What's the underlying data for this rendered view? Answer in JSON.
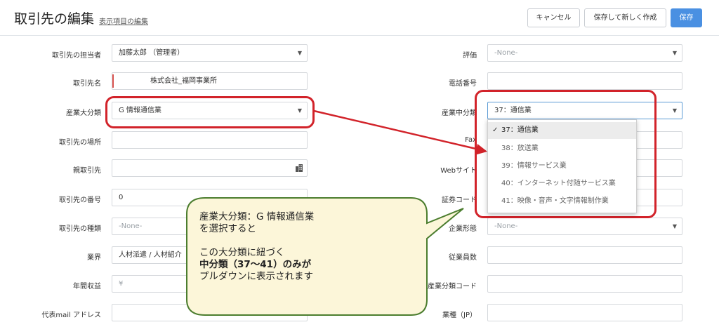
{
  "header": {
    "title": "取引先の編集",
    "subtitle_link": "表示項目の編集",
    "buttons": {
      "cancel": "キャンセル",
      "save_and_new": "保存して新しく作成",
      "save": "保存"
    }
  },
  "form": {
    "left": [
      {
        "label": "取引先の担当者",
        "value": "加藤太郎 （管理者）"
      },
      {
        "label": "取引先名",
        "value": "株式会社_福岡事業所"
      },
      {
        "label": "産業大分類",
        "value": "G 情報通信業"
      },
      {
        "label": "取引先の場所",
        "value": ""
      },
      {
        "label": "親取引先",
        "value": ""
      },
      {
        "label": "取引先の番号",
        "value": "0"
      },
      {
        "label": "取引先の種類",
        "value": "-None-"
      },
      {
        "label": "業界",
        "value": "人材派遣 / 人材紹介"
      },
      {
        "label": "年間収益",
        "value": "¥"
      },
      {
        "label": "代表mail アドレス",
        "value": ""
      }
    ],
    "right": [
      {
        "label": "評価",
        "value": "-None-"
      },
      {
        "label": "電話番号",
        "value": ""
      },
      {
        "label": "産業中分類",
        "value": "37：通信業"
      },
      {
        "label": "Fax",
        "value": ""
      },
      {
        "label": "Webサイト",
        "value": ""
      },
      {
        "label": "証券コード",
        "value": ""
      },
      {
        "label": "企業形態",
        "value": "-None-"
      },
      {
        "label": "従業員数",
        "value": ""
      },
      {
        "label": "産業分類コード",
        "value": ""
      },
      {
        "label": "業種（JP）",
        "value": ""
      }
    ]
  },
  "dropdown": {
    "options": [
      "37：通信業",
      "38：放送業",
      "39：情報サービス業",
      "40：インターネット付随サービス業",
      "41：映像・音声・文字情報制作業"
    ],
    "selected_index": 0
  },
  "annotation": {
    "lines": [
      "産業大分類：G 情報通信業",
      "を選択すると",
      "",
      "この大分類に紐づく",
      "中分類（37〜41）のみが",
      "プルダウンに表示されます"
    ],
    "colors": {
      "highlight": "#d2232a",
      "bubble_fill": "#fcf6d9",
      "bubble_border": "#4b7d2e"
    }
  },
  "colors": {
    "primary": "#4a90e2",
    "required": "#d9534f"
  }
}
